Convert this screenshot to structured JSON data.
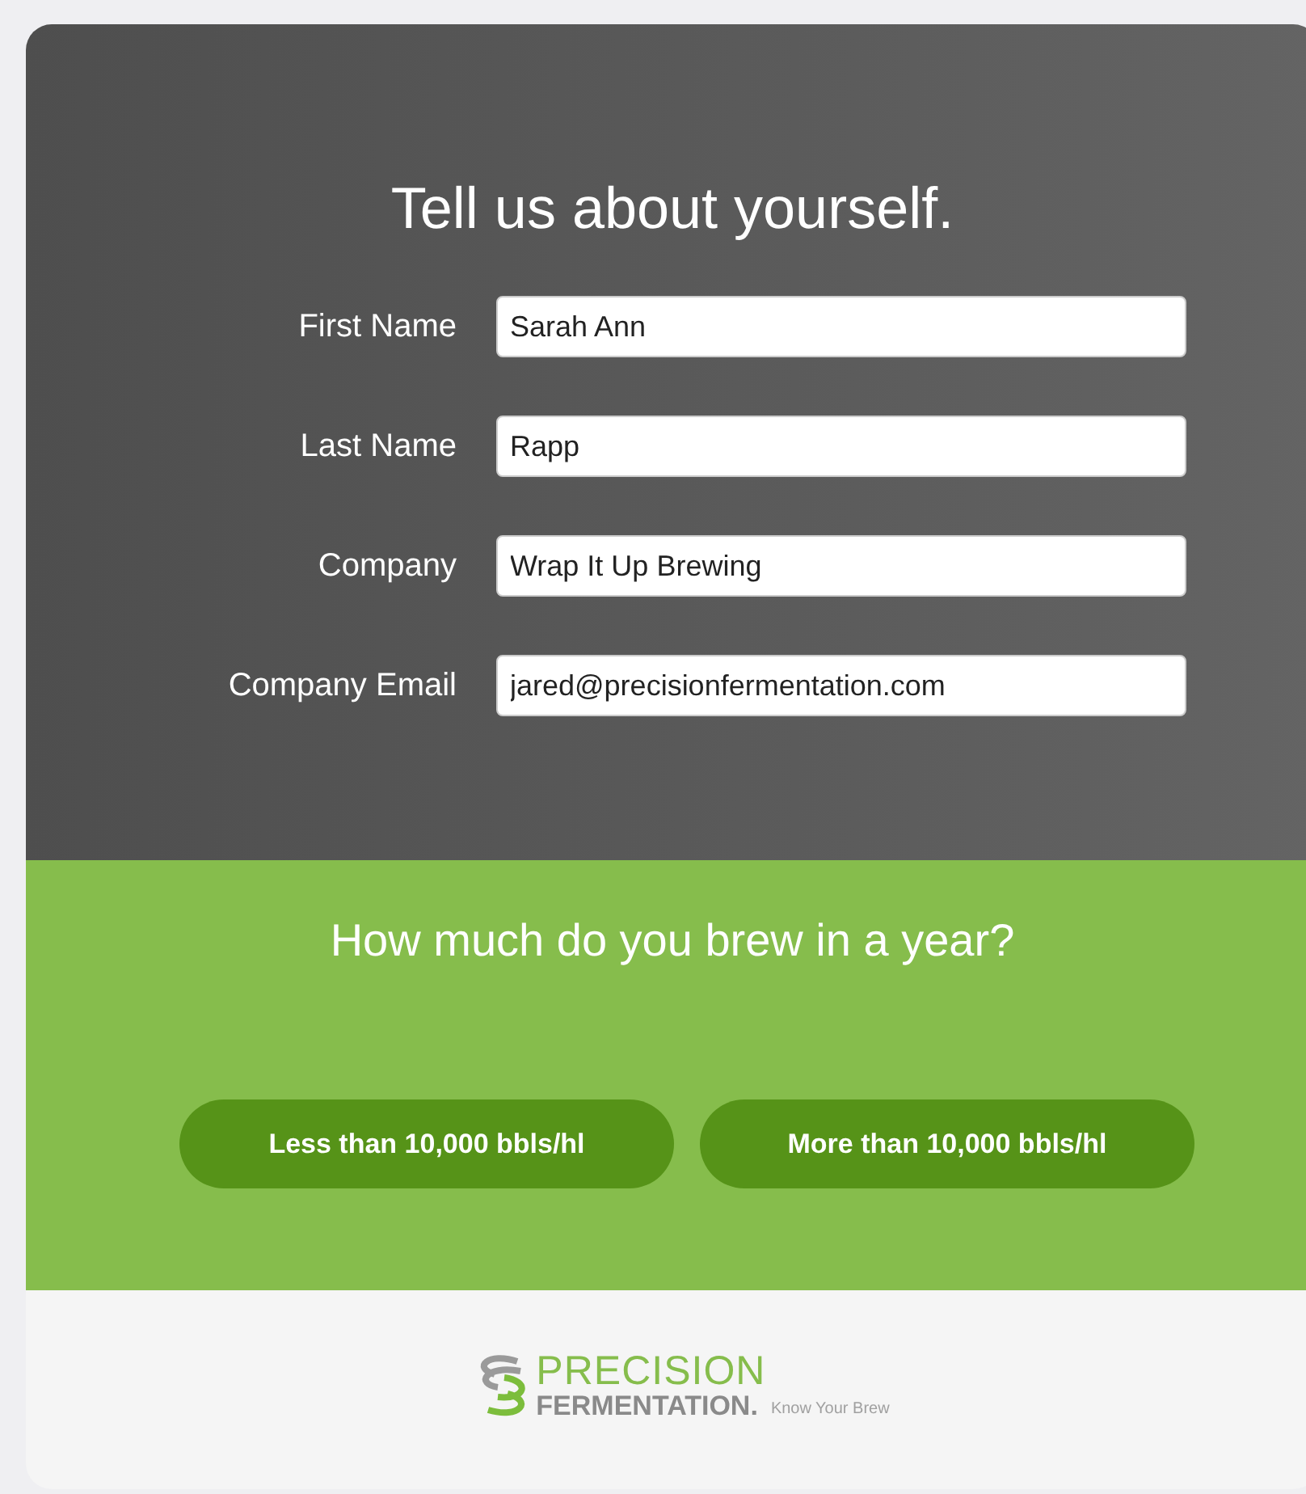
{
  "form": {
    "title": "Tell us about yourself.",
    "fields": [
      {
        "label": "First Name",
        "value": "Sarah Ann"
      },
      {
        "label": "Last Name",
        "value": "Rapp"
      },
      {
        "label": "Company",
        "value": "Wrap It Up Brewing"
      },
      {
        "label": "Company Email",
        "value": "jared@precisionfermentation.com"
      }
    ]
  },
  "volume": {
    "question": "How much do you brew in a year?",
    "buttons": [
      "Less than 10,000 bbls/hl",
      "More than 10,000 bbls/hl"
    ]
  },
  "footer": {
    "logo_top": "PRECISION",
    "logo_bottom": "FERMENTATION",
    "logo_mark": ".",
    "tagline": "Know Your Brew"
  }
}
